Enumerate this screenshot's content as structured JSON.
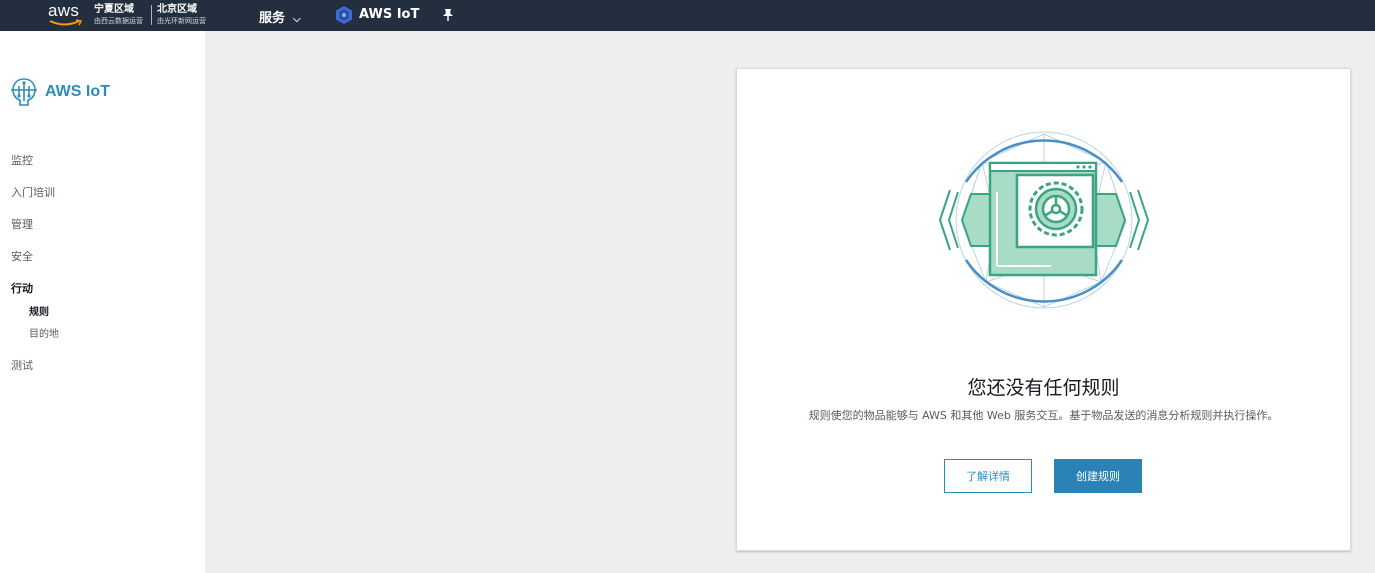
{
  "topbar": {
    "logo_text": "aws",
    "region1_title": "宁夏区域",
    "region1_sub": "由西云数据运营",
    "region2_title": "北京区域",
    "region2_sub": "由光环新网运营",
    "services_label": "服务",
    "service_name": "AWS IoT"
  },
  "sidebar": {
    "brand": "AWS IoT",
    "items": [
      {
        "label": "监控"
      },
      {
        "label": "入门培训"
      },
      {
        "label": "管理"
      },
      {
        "label": "安全"
      },
      {
        "label": "行动"
      },
      {
        "label": "测试"
      }
    ],
    "subitems": [
      {
        "label": "规则"
      },
      {
        "label": "目的地"
      }
    ]
  },
  "main": {
    "title": "您还没有任何规则",
    "description": "规则使您的物品能够与 AWS 和其他 Web 服务交互。基于物品发送的消息分析规则并执行操作。",
    "learn_more": "了解详情",
    "create_rule": "创建规则"
  },
  "colors": {
    "topbar": "#232f3e",
    "accent": "#2b8dba",
    "primary_button": "#2a82b5",
    "illustration_green": "#3aa57f"
  }
}
